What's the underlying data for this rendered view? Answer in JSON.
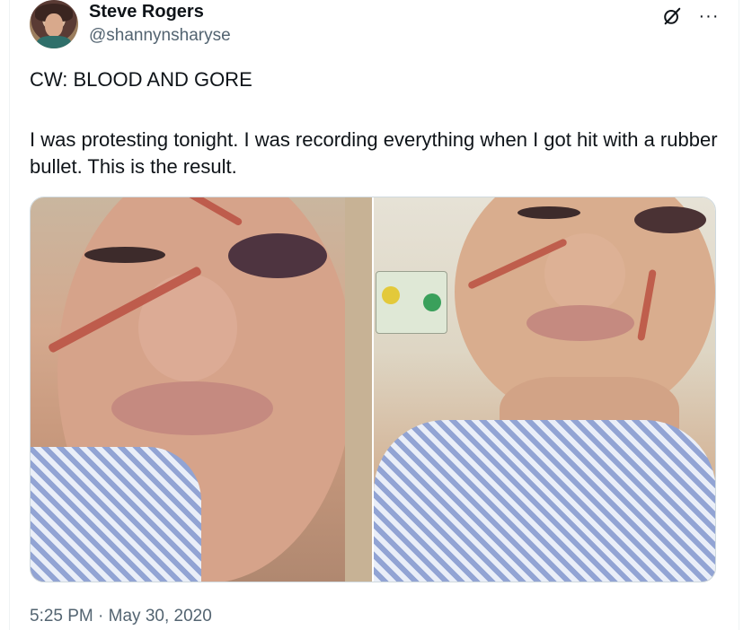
{
  "tweet": {
    "author": {
      "name": "Steve Rogers",
      "handle": "@shannynsharyse"
    },
    "content_warning": "CW: BLOOD AND GORE",
    "body": "I was protesting tonight. I was recording everything when I got hit with a rubber bullet. This is the result.",
    "timestamp": "5:25 PM · May 30, 2020",
    "actions": {
      "grok_icon": "grok-icon",
      "more": "···"
    },
    "media": [
      {
        "id": "photo-1",
        "icon": "photo"
      },
      {
        "id": "photo-2",
        "icon": "photo"
      }
    ]
  },
  "colors": {
    "text": "#0f1419",
    "secondary": "#536471",
    "border": "#cfd9de"
  }
}
